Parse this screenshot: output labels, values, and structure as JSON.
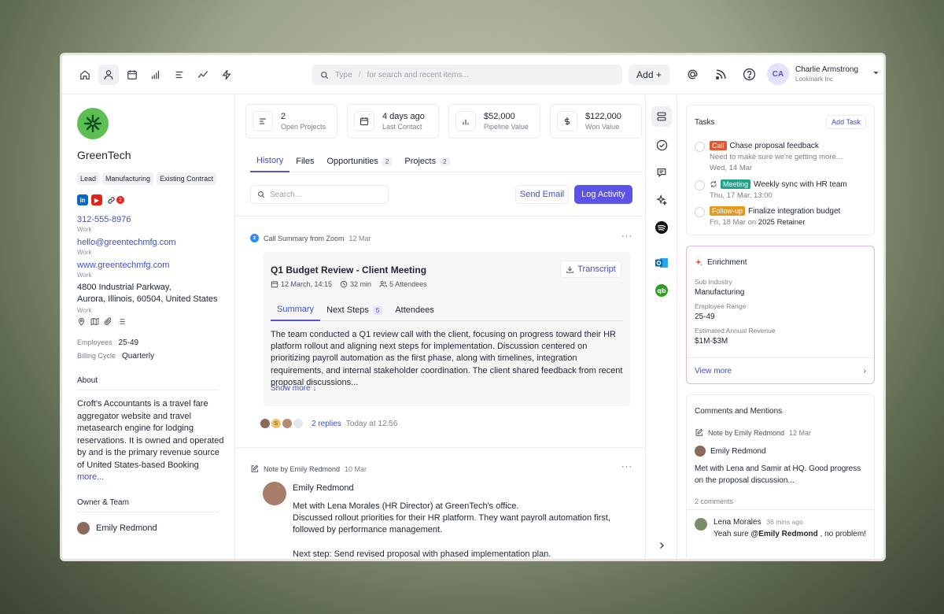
{
  "topbar": {
    "search_type": "Type",
    "search_sep": "/",
    "search_placeholder": "for search and recent items...",
    "add_label": "Add +",
    "user_initials": "CA",
    "user_name": "Charlie Armstrong",
    "user_org": "Lookmark Inc"
  },
  "company": {
    "name": "GreenTech",
    "tags": [
      "Lead",
      "Manufacturing",
      "Existing Contract"
    ],
    "mention_count": "2",
    "phone": "312-555-8976",
    "phone_type": "Work",
    "email": "hello@greentechmfg.com",
    "email_type": "Work",
    "website": "www.greentechmfg.com",
    "website_type": "Work",
    "address_line1": "4800 Industrial Parkway,",
    "address_line2": "Aurora, Illinois, 60504, United States",
    "address_type": "Work",
    "employees_label": "Employees",
    "employees_value": "25-49",
    "billing_label": "Billing Cycle",
    "billing_value": "Quarterly",
    "about_title": "About",
    "about_text": "Croft's Accountants is a travel fare aggregator website and travel metasearch engine for lodging reservations. It is owned and operated by and is the primary revenue source of United States-based Booking",
    "about_more": "more...",
    "owner_title": "Owner & Team",
    "owner_name": "Emily Redmond"
  },
  "stats": [
    {
      "value": "2",
      "label": "Open Projects",
      "icon": "list-icon"
    },
    {
      "value": "4 days ago",
      "label": "Last Contact",
      "icon": "calendar-icon"
    },
    {
      "value": "$52,000",
      "label": "Pipeline Value",
      "icon": "bar-chart-icon"
    },
    {
      "value": "$122,000",
      "label": "Won Value",
      "icon": "dollar-icon"
    }
  ],
  "tabs": [
    {
      "label": "History",
      "count": ""
    },
    {
      "label": "Files",
      "count": ""
    },
    {
      "label": "Opportunities",
      "count": "2"
    },
    {
      "label": "Projects",
      "count": "2"
    }
  ],
  "history": {
    "search_placeholder": "Search...",
    "send_email": "Send Email",
    "log_activity": "Log Activity",
    "call_head": "Call Summary from Zoom",
    "call_date": "12 Mar",
    "card_title": "Q1 Budget Review - Client Meeting",
    "card_date": "12 March, 14:15",
    "card_duration": "32 min",
    "card_attendees": "5 Attendees",
    "transcript": "Transcript",
    "card_tabs": [
      {
        "label": "Summary",
        "count": ""
      },
      {
        "label": "Next Steps",
        "count": "5"
      },
      {
        "label": "Attendees",
        "count": ""
      }
    ],
    "card_body": "The team conducted a Q1 review call with the client, focusing on progress toward their HR platform rollout and aligning next steps for implementation. Discussion centered on prioritizing payroll automation as the first phase, along with timelines, integration requirements, and internal stakeholder coordination. The client shared feedback from recent proposal discussions...",
    "show_more": "Show more ↓",
    "reply_badge": "S",
    "replies": "2 replies",
    "replies_time": "Today at 12:56",
    "note_head": "Note by Emily Redmond",
    "note_date": "10 Mar",
    "note_author": "Emily Redmond",
    "note_line1": "Met with Lena Morales (HR Director) at GreenTech's office.",
    "note_line2": "Discussed rollout priorities for their HR platform. They want payroll automation first, followed by performance management.",
    "note_line3": "Next step: Send revised proposal with phased implementation plan."
  },
  "tasks": {
    "title": "Tasks",
    "add": "Add Task",
    "items": [
      {
        "tag": "Call",
        "tag_color": "#e4572e",
        "title": "Chase proposal feedback",
        "sub1": "Need to make sure we're getting more...",
        "sub2": "Wed, 14 Mar"
      },
      {
        "tag": "Meeting",
        "tag_color": "#1fa38a",
        "title": "Weekly sync with HR team",
        "sub1": "",
        "sub2": "Thu, 17 Mar, 13:00"
      },
      {
        "tag": "Follow-up",
        "tag_color": "#e59a1d",
        "title": "Finalize integration budget",
        "sub1": "",
        "sub2": "Fri, 18 Mar",
        "sub2_on": "on",
        "sub2_link": "2025 Retainer"
      }
    ]
  },
  "enrichment": {
    "title": "Enrichment",
    "fields": [
      {
        "label": "Sub Industry",
        "value": "Manufacturing"
      },
      {
        "label": "Employee Range",
        "value": "25-49"
      },
      {
        "label": "Estimated Annual Revenue",
        "value": "$1M-$3M"
      }
    ],
    "view_more": "View more",
    "arrow": "›"
  },
  "comments": {
    "title": "Comments and Mentions",
    "note_head": "Note by Emily Redmond",
    "note_date": "12 Mar",
    "author": "Emily Redmond",
    "text": "Met with Lena and Samir at HQ. Good progress on the proposal discussion...",
    "count": "2 comments",
    "reply_author": "Lena Morales",
    "reply_time": "36 mins ago",
    "reply_prefix": "Yeah sure",
    "reply_mention": "@Emily Redmond",
    "reply_suffix": ", no problem!"
  },
  "colors": {
    "accent": "#5b53e6",
    "link": "#3f4fc7",
    "brand_green": "#5cbf52"
  }
}
